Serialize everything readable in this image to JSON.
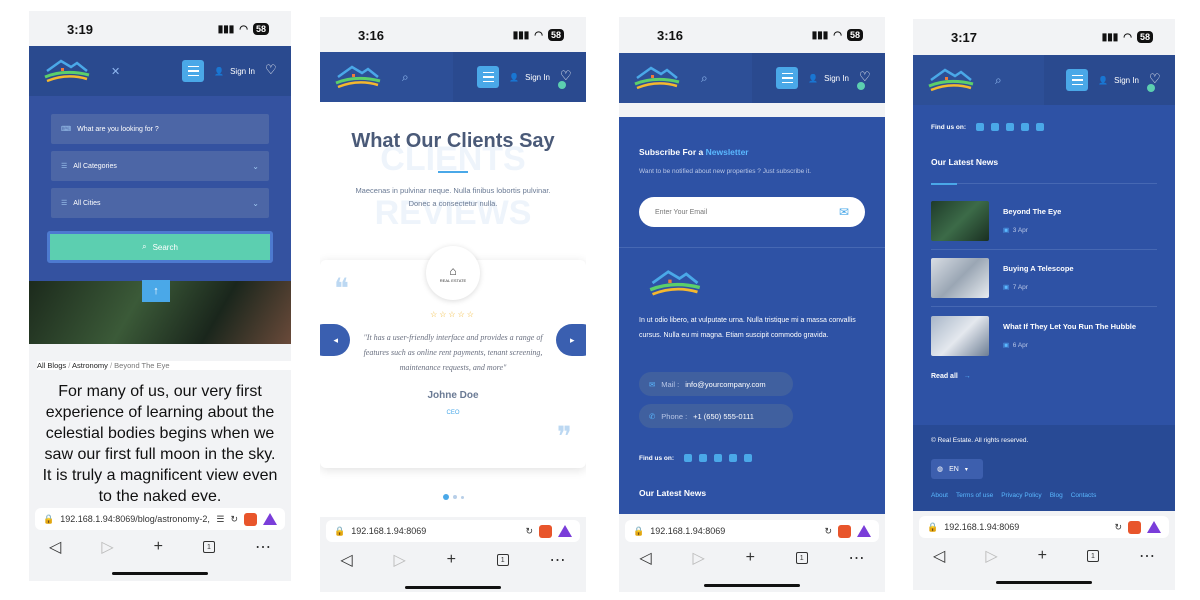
{
  "status_times": [
    "3:19",
    "3:16",
    "3:16",
    "3:17"
  ],
  "battery": "58",
  "header": {
    "signin_label": "Sign In",
    "close_glyph": "✕"
  },
  "phone1": {
    "search_placeholder": "What are you looking for ?",
    "categories_label": "All Categories",
    "cities_label": "All Cities",
    "search_button": "Search",
    "breadcrumb": [
      "All Blogs",
      "Astronomy",
      "Beyond The Eye"
    ],
    "body_text": "For many of us, our very first experience of learning about the celestial bodies begins when we saw our first full moon in the sky. It is truly a magnificent view even to the naked eye.",
    "url": "192.168.1.94:8069/blog/astronomy-2,"
  },
  "phone2": {
    "title": "What Our Clients Say",
    "bg_word_1": "CLIENTS",
    "bg_word_2": "REVIEWS",
    "subtitle": "Maecenas in pulvinar neque. Nulla finibus lobortis pulvinar. Donec a consectetur nulla.",
    "logo_text": "REAL ESTATE",
    "stars": "☆☆☆☆☆",
    "quote": "\"It has a user-friendly interface and provides a range of features such as online rent payments, tenant screening, maintenance requests, and more\"",
    "name": "Johne Doe",
    "role": "CEO",
    "url": "192.168.1.94:8069"
  },
  "phone3": {
    "newsletter_prefix": "Subscribe For a ",
    "newsletter_highlight": "Newsletter",
    "newsletter_sub": "Want to be notified about new properties ? Just subscribe it.",
    "email_placeholder": "Enter Your Email",
    "about_text": "In ut odio libero, at vulputate urna. Nulla tristique mi a massa convallis cursus. Nulla eu mi magna. Etiam suscipit commodo gravida.",
    "mail_label": "Mail : ",
    "mail_value": "info@yourcompany.com",
    "phone_label": "Phone : ",
    "phone_value": "+1 (650) 555-0111",
    "find_us": "Find us on:",
    "latest_news": "Our Latest News",
    "url": "192.168.1.94:8069"
  },
  "phone4": {
    "find_us": "Find us on:",
    "latest_news": "Our Latest News",
    "news": [
      {
        "title": "Beyond The Eye",
        "date": "3 Apr"
      },
      {
        "title": "Buying A Telescope",
        "date": "7 Apr"
      },
      {
        "title": "What If They Let You Run The Hubble",
        "date": "6 Apr"
      }
    ],
    "read_all": "Read all",
    "copyright": "© Real Estate. All rights reserved.",
    "lang": "EN",
    "footer_links": [
      "About",
      "Terms of use",
      "Privacy Policy",
      "Blog",
      "Contacts"
    ],
    "url": "192.168.1.94:8069"
  },
  "colors": {
    "header": "#2a4a8f",
    "panel": "#3452a0",
    "accent": "#4aa8e8",
    "green": "#5ccfb0"
  }
}
